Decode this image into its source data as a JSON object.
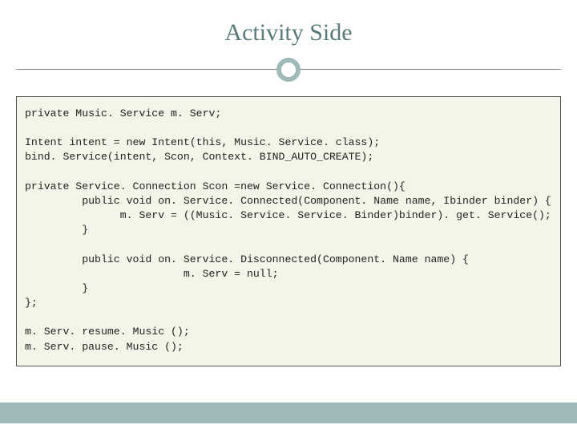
{
  "title": "Activity Side",
  "code": {
    "l01": "private Music. Service m. Serv;",
    "l02": "Intent intent = new Intent(this, Music. Service. class);",
    "l03": "bind. Service(intent, Scon, Context. BIND_AUTO_CREATE);",
    "l04": "private Service. Connection Scon =new Service. Connection(){",
    "l05": "         public void on. Service. Connected(Component. Name name, Ibinder binder) {",
    "l06": "               m. Serv = ((Music. Service. Service. Binder)binder). get. Service();",
    "l07": "         }",
    "l08": "         public void on. Service. Disconnected(Component. Name name) {",
    "l09": "                         m. Serv = null;",
    "l10": "         }",
    "l11": "};",
    "l12": "m. Serv. resume. Music ();",
    "l13": "m. Serv. pause. Music ();"
  }
}
